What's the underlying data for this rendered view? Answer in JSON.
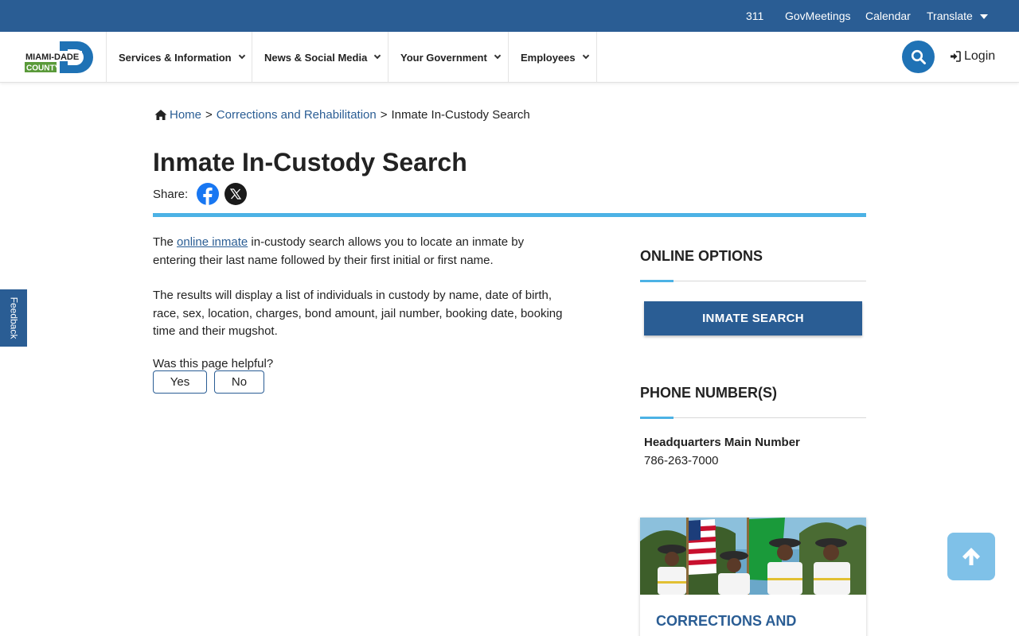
{
  "utility": {
    "links": [
      "311",
      "GovMeetings",
      "Calendar"
    ],
    "translate_label": "Translate"
  },
  "logo": {
    "line1": "MIAMI-DADE",
    "line2": "COUNTY"
  },
  "nav": {
    "items": [
      "Services & Information",
      "News & Social Media",
      "Your Government",
      "Employees"
    ],
    "login_label": "Login"
  },
  "feedback_label": "Feedback",
  "breadcrumb": {
    "home": "Home",
    "parent": "Corrections and Rehabilitation",
    "current": "Inmate In-Custody Search",
    "separator": ">"
  },
  "page": {
    "title": "Inmate In-Custody Search",
    "share_label": "Share:",
    "intro_prefix": "The ",
    "intro_link": "online inmate",
    "intro_suffix": " in-custody search allows you to locate an inmate by entering their last name followed by their first initial or first name.",
    "results_text": "The results will display a list of individuals in custody by name, date of birth, race, sex, location, charges, bond amount, jail number, booking date, booking time and their mugshot.",
    "helpful_question": "Was this page helpful?",
    "yes_label": "Yes",
    "no_label": "No"
  },
  "sidebar": {
    "online_options_heading": "ONLINE OPTIONS",
    "inmate_search_button": "INMATE SEARCH",
    "phone_heading": "PHONE NUMBER(S)",
    "hq_label": "Headquarters Main Number",
    "hq_phone": "786-263-7000",
    "promo_title": "CORRECTIONS AND"
  },
  "colors": {
    "brand_blue": "#2a5d94",
    "accent_light_blue": "#4cb2e5",
    "search_blue": "#1f72b5",
    "back_to_top": "#7fc1e8"
  },
  "icons": [
    "home-icon",
    "facebook-icon",
    "x-icon",
    "search-icon",
    "login-icon",
    "arrow-up-icon"
  ]
}
